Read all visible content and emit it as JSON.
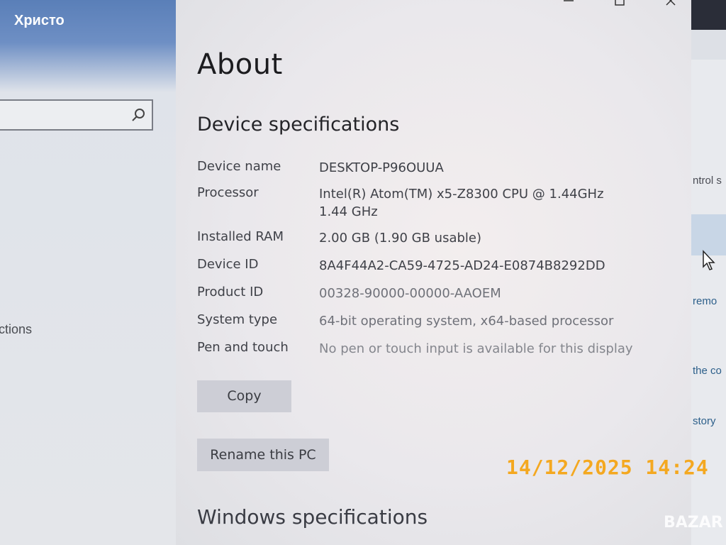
{
  "left_pane": {
    "user_name": "Христо",
    "partial_nav_text": "ctions"
  },
  "window": {
    "page_title": "About",
    "device_section_title": "Device specifications",
    "specs": [
      {
        "label": "Device name",
        "value": "DESKTOP-P96OUUA"
      },
      {
        "label": "Processor",
        "value": "Intel(R) Atom(TM) x5-Z8300  CPU @ 1.44GHz   1.44 GHz"
      },
      {
        "label": "Installed RAM",
        "value": "2.00 GB (1.90 GB usable)"
      },
      {
        "label": "Device ID",
        "value": "8A4F44A2-CA59-4725-AD24-E0874B8292DD"
      },
      {
        "label": "Product ID",
        "value": "00328-90000-00000-AAOEM"
      },
      {
        "label": "System type",
        "value": "64-bit operating system, x64-based processor"
      },
      {
        "label": "Pen and touch",
        "value": "No pen or touch input is available for this display"
      }
    ],
    "copy_label": "Copy",
    "rename_label": "Rename this PC",
    "windows_section_title": "Windows specifications"
  },
  "right_pane": {
    "text_control": "ntrol s",
    "text_remove": "remo",
    "text_the": "the co",
    "text_story": "story"
  },
  "overlay": {
    "timestamp": "14/12/2025  14:24",
    "watermark": "BAZAR"
  }
}
